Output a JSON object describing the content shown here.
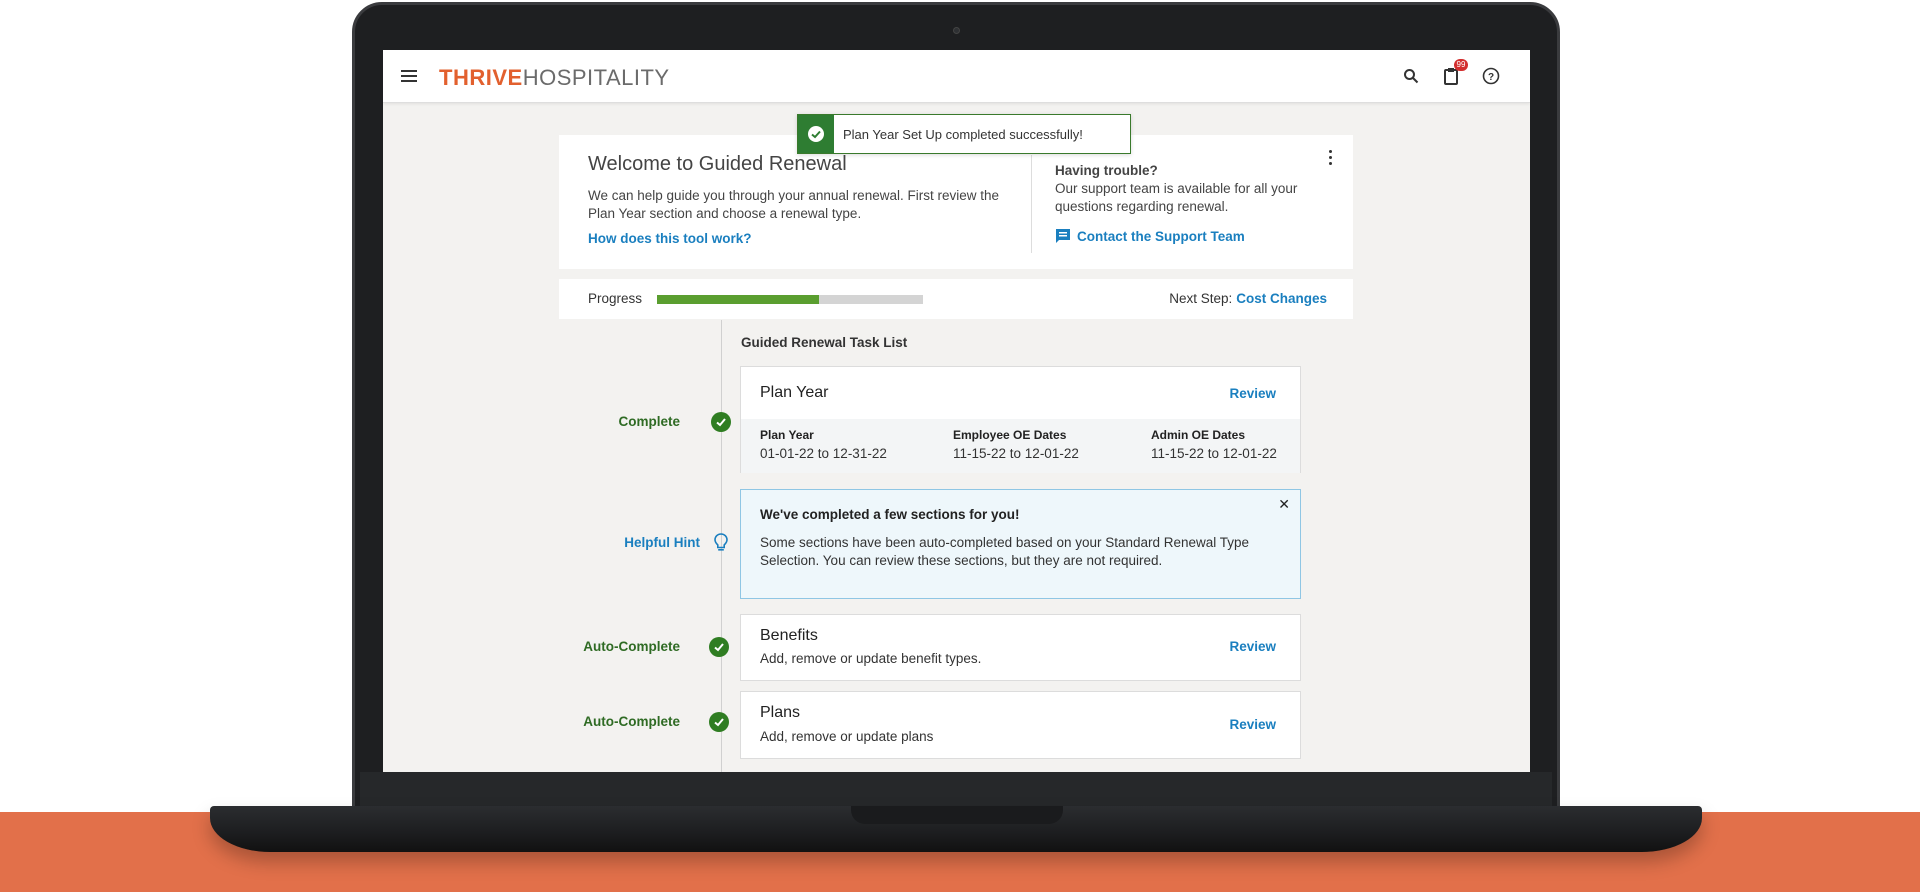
{
  "app": {
    "logo_part1": "THRIVE",
    "logo_part2": "HOSPITALITY",
    "cart_badge": "99"
  },
  "toast": {
    "message": "Plan Year Set Up completed successfully!"
  },
  "welcome": {
    "title": "Welcome to Guided Renewal",
    "description": "We can help guide you through your annual renewal. First review the Plan Year section and choose a renewal type.",
    "help_link": "How does this tool work?",
    "trouble_title": "Having trouble?",
    "trouble_desc": "Our support team is available for all your questions regarding renewal.",
    "contact_link": "Contact the Support Team"
  },
  "progress": {
    "label": "Progress",
    "percent": 61,
    "next_step_label": "Next Step:",
    "next_step_value": "Cost Changes"
  },
  "task_list": {
    "heading": "Guided Renewal Task List",
    "plan_year": {
      "status": "Complete",
      "title": "Plan Year",
      "review": "Review",
      "fields": [
        {
          "label": "Plan Year",
          "value": "01-01-22 to 12-31-22"
        },
        {
          "label": "Employee OE Dates",
          "value": "11-15-22 to 12-01-22"
        },
        {
          "label": "Admin OE Dates",
          "value": "11-15-22 to 12-01-22"
        }
      ]
    },
    "hint": {
      "status": "Helpful Hint",
      "title": "We've completed a few sections for you!",
      "description": "Some sections have been auto-completed based on your Standard Renewal Type Selection. You can review these sections, but they are not required."
    },
    "benefits": {
      "status": "Auto-Complete",
      "title": "Benefits",
      "description": "Add, remove or update benefit types.",
      "review": "Review"
    },
    "plans": {
      "status": "Auto-Complete",
      "title": "Plans",
      "description": "Add, remove or update plans",
      "review": "Review"
    }
  },
  "colors": {
    "brand_orange": "#e2602e",
    "link_blue": "#1a7fbf",
    "success_green": "#2f7d22",
    "progress_green": "#5a9e2f"
  }
}
